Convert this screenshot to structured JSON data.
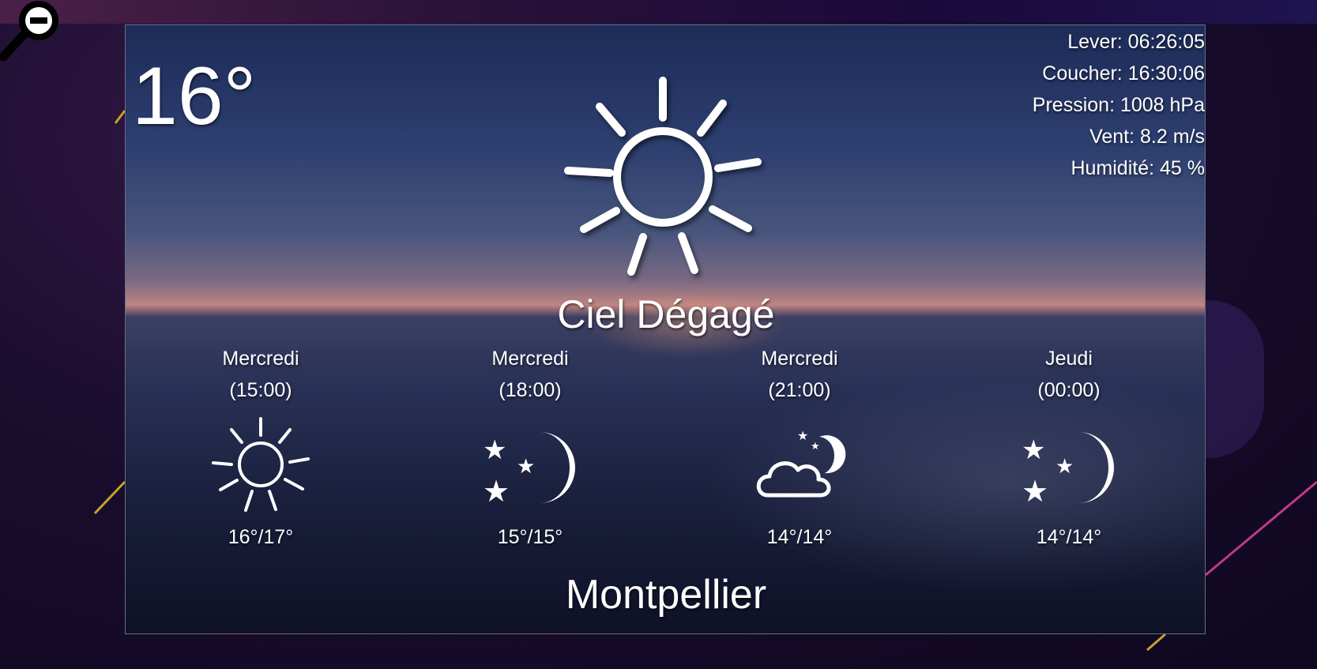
{
  "current": {
    "temperature": "16°",
    "condition": "Ciel Dégagé",
    "icon": "sun-icon"
  },
  "details": {
    "sunrise": "Lever: 06:26:05",
    "sunset": "Coucher: 16:30:06",
    "pressure": "Pression: 1008 hPa",
    "wind": "Vent: 8.2 m/s",
    "humidity": "Humidité: 45 %"
  },
  "forecast": [
    {
      "day": "Mercredi",
      "time": "(15:00)",
      "temps": "16°/17°",
      "icon": "sun-icon"
    },
    {
      "day": "Mercredi",
      "time": "(18:00)",
      "temps": "15°/15°",
      "icon": "moon-stars-icon"
    },
    {
      "day": "Mercredi",
      "time": "(21:00)",
      "temps": "14°/14°",
      "icon": "cloud-moon-icon"
    },
    {
      "day": "Jeudi",
      "time": "(00:00)",
      "temps": "14°/14°",
      "icon": "moon-stars-icon"
    }
  ],
  "city": "Montpellier",
  "colors": {
    "text": "#ffffff",
    "accent_line_gold": "#c9a227",
    "accent_line_pink": "#c03a8a"
  },
  "controls": {
    "zoom_icon": "zoom-out-icon"
  }
}
